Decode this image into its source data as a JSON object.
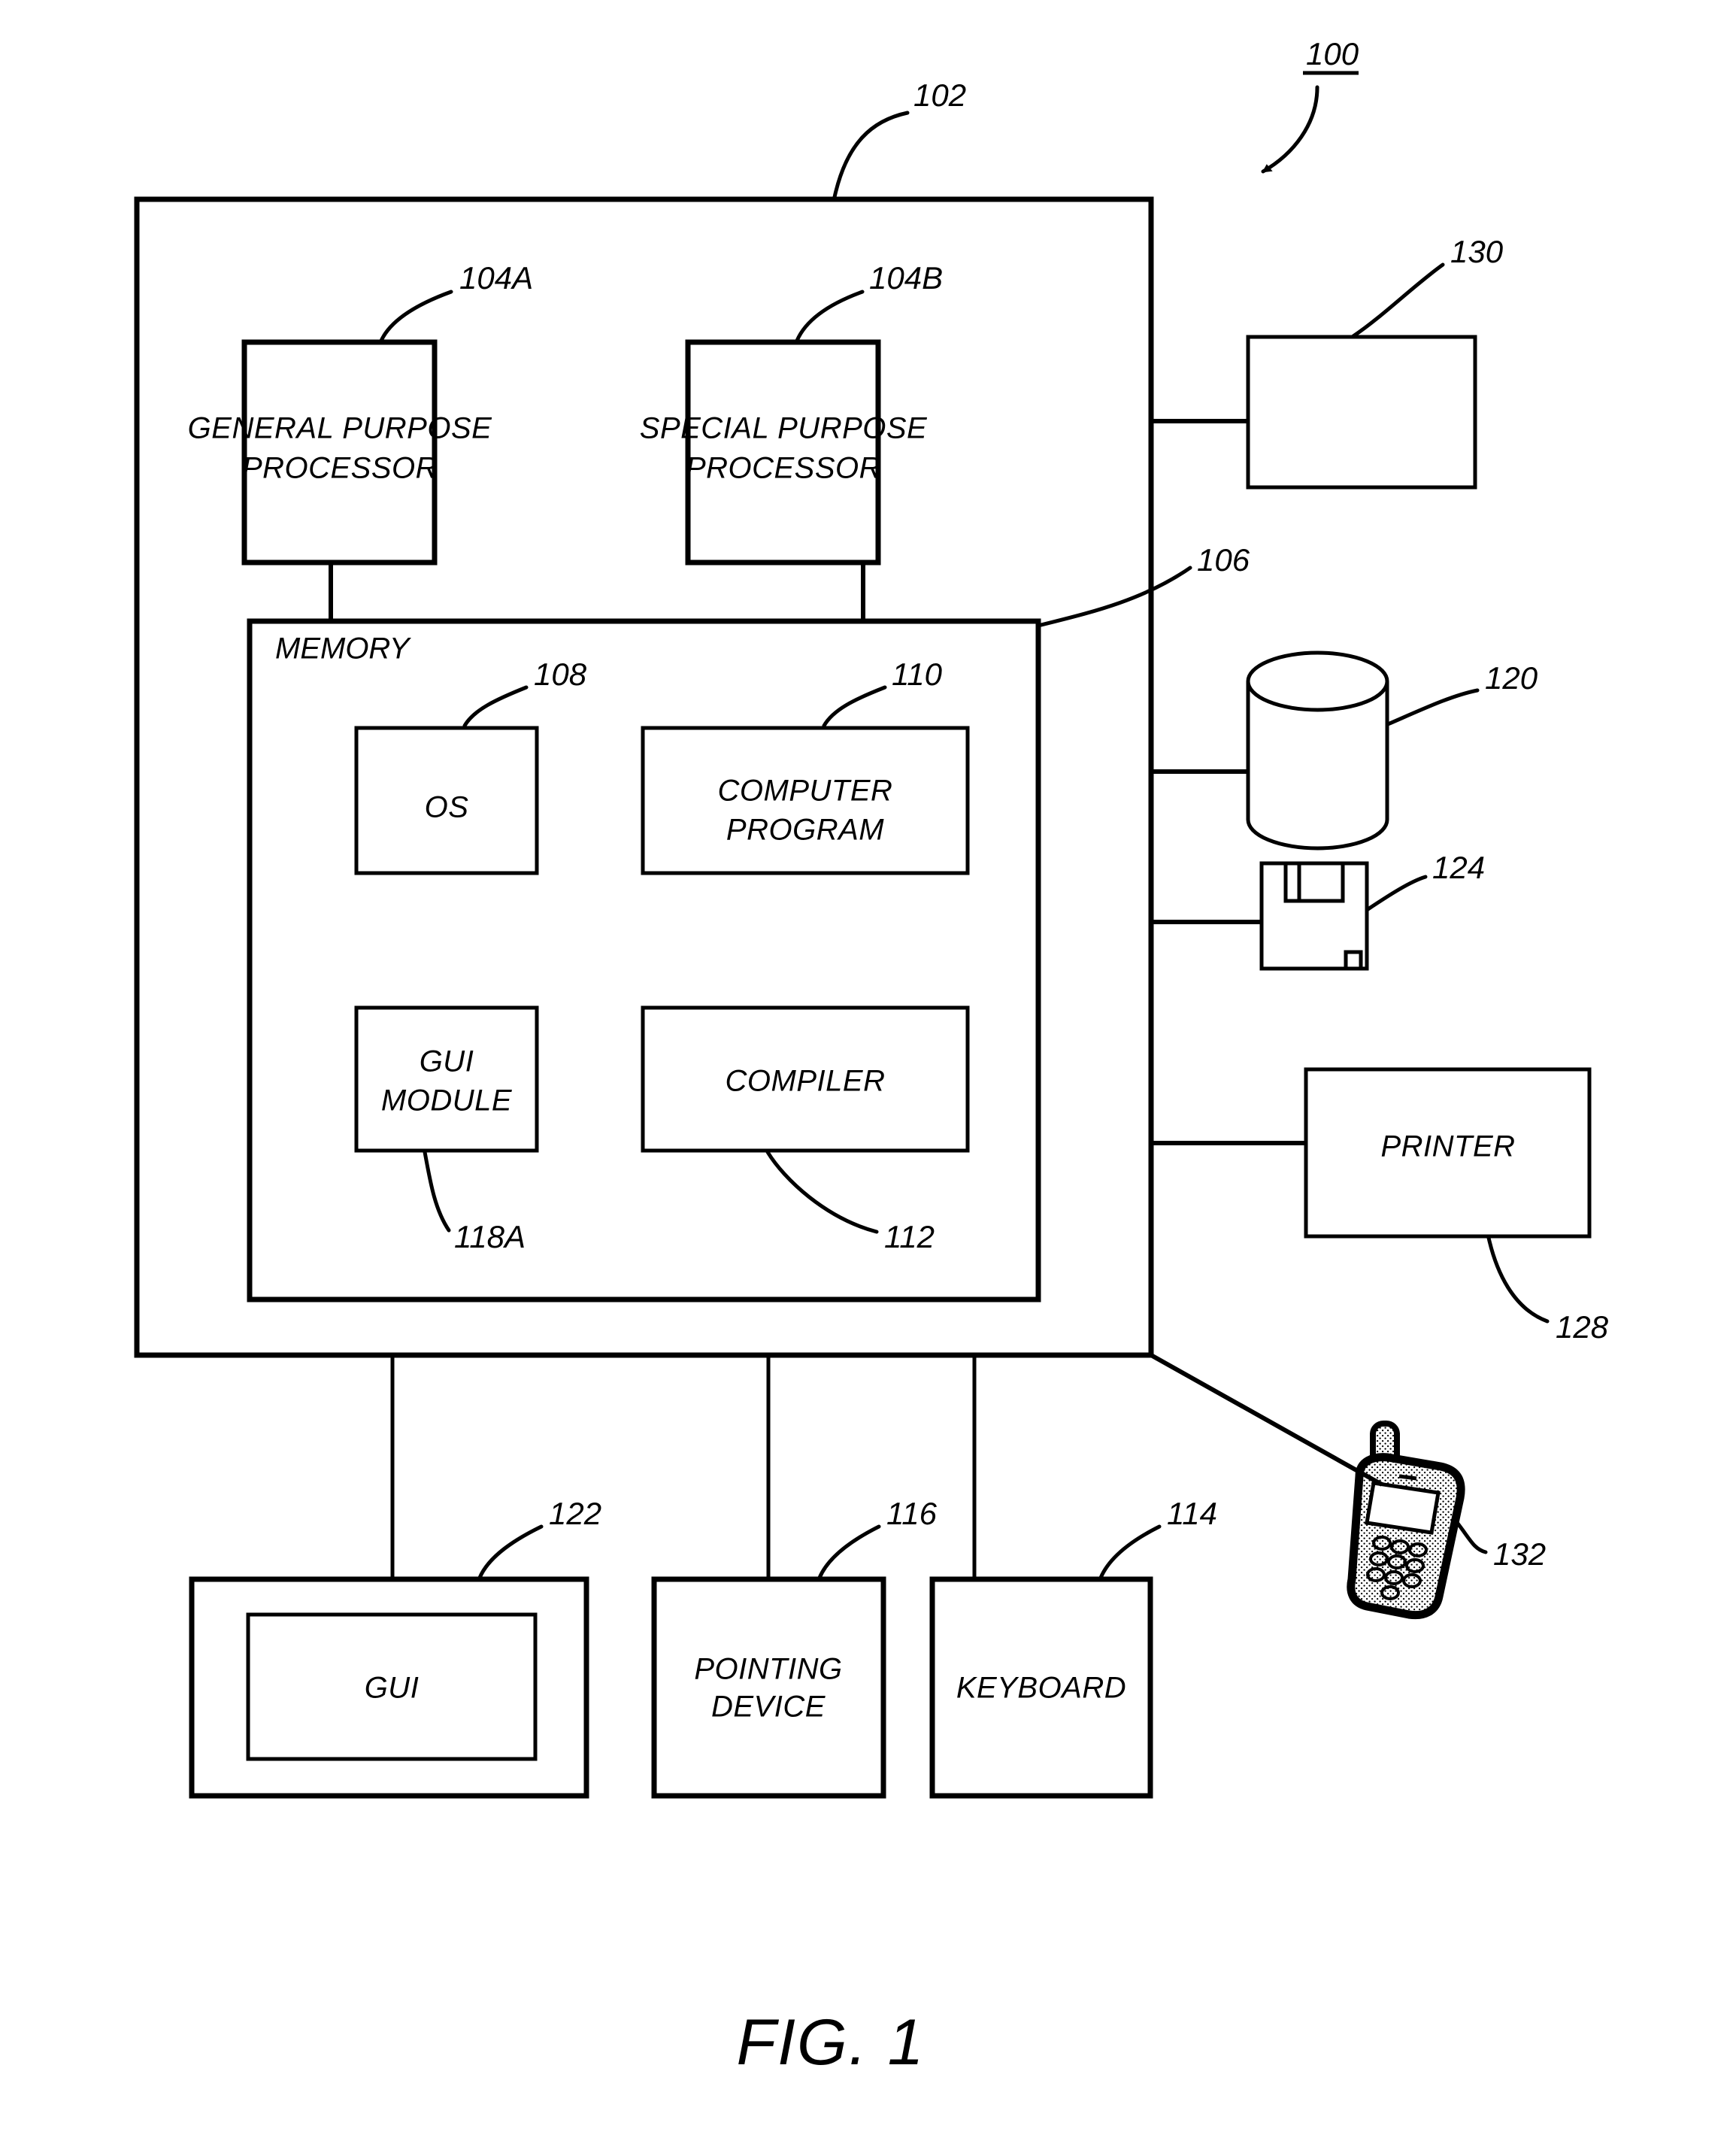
{
  "figure": {
    "caption": "FIG. 1",
    "system_ref": "100"
  },
  "computer": {
    "ref": "102",
    "memory": {
      "label": "MEMORY",
      "ref": "106",
      "modules": [
        {
          "label": "OS",
          "ref": "108"
        },
        {
          "label": "COMPUTER PROGRAM",
          "line1": "COMPUTER",
          "line2": "PROGRAM",
          "ref": "110"
        },
        {
          "label": "GUI MODULE",
          "line1": "GUI",
          "line2": "MODULE",
          "ref": "118A"
        },
        {
          "label": "COMPILER",
          "ref": "112"
        }
      ]
    },
    "processors": [
      {
        "label": "GENERAL PURPOSE PROCESSOR",
        "line1": "GENERAL PURPOSE",
        "line2": "PROCESSOR",
        "ref": "104A"
      },
      {
        "label": "SPECIAL PURPOSE PROCESSOR",
        "line1": "SPECIAL PURPOSE",
        "line2": "PROCESSOR",
        "ref": "104B"
      }
    ]
  },
  "peripherals_right": [
    {
      "name": "unlabeled-box",
      "label": "",
      "ref": "130",
      "icon": "rectangle-icon"
    },
    {
      "name": "data-storage",
      "label": "",
      "ref": "120",
      "icon": "cylinder-database-icon"
    },
    {
      "name": "removable-media",
      "label": "",
      "ref": "124",
      "icon": "floppy-disk-icon"
    },
    {
      "name": "printer",
      "label": "PRINTER",
      "ref": "128",
      "icon": "printer-box-icon"
    },
    {
      "name": "mobile-phone",
      "label": "",
      "ref": "132",
      "icon": "mobile-phone-icon"
    }
  ],
  "peripherals_bottom": [
    {
      "name": "gui-display",
      "label": "GUI",
      "ref": "122",
      "icon": "display-screen-icon"
    },
    {
      "name": "pointing-device",
      "label": "POINTING DEVICE",
      "line1": "POINTING",
      "line2": "DEVICE",
      "ref": "116",
      "icon": "pointing-device-icon"
    },
    {
      "name": "keyboard",
      "label": "KEYBOARD",
      "ref": "114",
      "icon": "keyboard-icon"
    }
  ],
  "colors": {
    "stroke": "#000000",
    "background": "#ffffff"
  }
}
